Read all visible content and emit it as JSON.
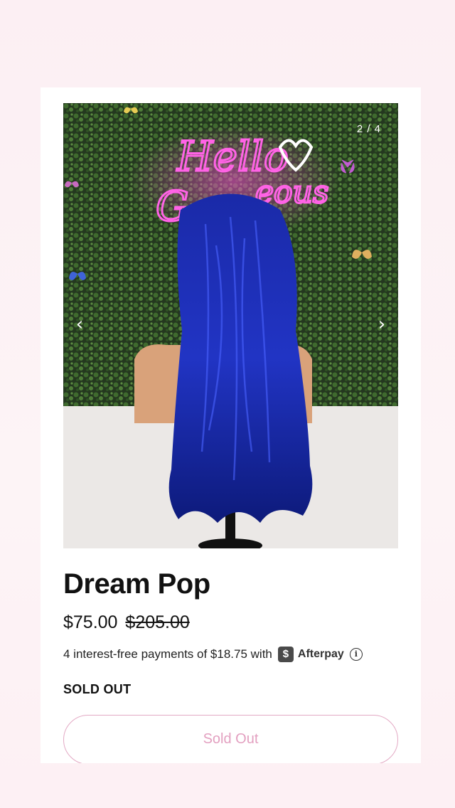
{
  "gallery": {
    "counter": "2 / 4",
    "prev_icon": "chevron-left-icon",
    "next_icon": "chevron-right-icon",
    "sign_text": "Hello Gorgeous"
  },
  "product": {
    "title": "Dream Pop",
    "price": "$75.00",
    "compare_price": "$205.00",
    "installments_text": "4 interest-free payments of $18.75 with",
    "afterpay_badge": "$",
    "afterpay_name": "Afterpay",
    "info_icon_glyph": "i",
    "stock_status": "SOLD OUT",
    "button_label": "Sold Out"
  },
  "colors": {
    "background": "#fdf1f4",
    "button_border": "#e3a9c4",
    "button_text": "#e3a0c0"
  }
}
